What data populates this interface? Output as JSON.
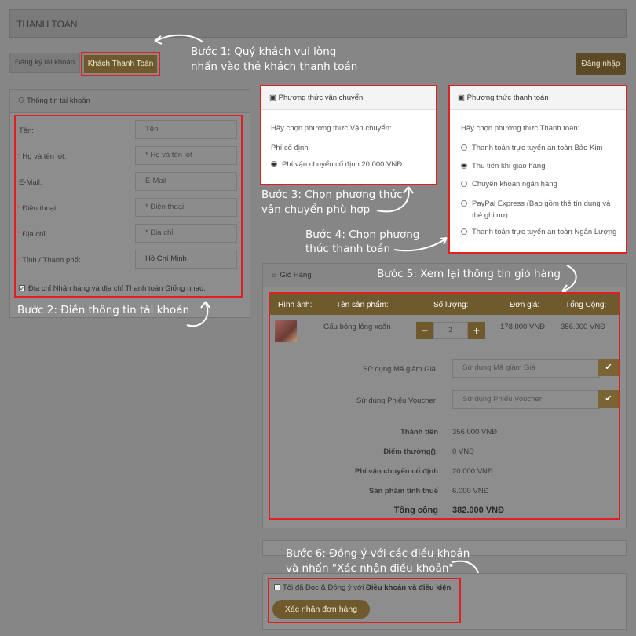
{
  "header": {
    "title": "THANH TOÁN"
  },
  "tabs": {
    "register": "Đăng ký tài khoản",
    "guest": "Khách Thanh Toán"
  },
  "login_button": "Đăng nhập",
  "steps": {
    "s1_line1": "Bước 1: Quý khách vui lòng",
    "s1_line2": "nhấn vào thẻ khách thanh toán",
    "s2": "Bước 2: Điền thông tin tài khoản",
    "s3_line1": "Bước 3: Chọn phương thức",
    "s3_line2": "vận chuyển phù hợp",
    "s4_line1": "Bước 4: Chọn phương",
    "s4_line2": "thức thanh toán",
    "s5": "Bước 5: Xem lại thông tin giỏ hàng",
    "s6_line1": "Bước 6: Đồng ý với các điều khoản",
    "s6_line2": "và nhấn \"Xác nhận điều khoản\""
  },
  "account": {
    "title": "Thông tin tài khoản",
    "fields": [
      {
        "label": "Tên:",
        "required": false,
        "placeholder": "Tên"
      },
      {
        "label": "Họ và tên lót:",
        "required": true,
        "placeholder": "* Họ và tên lót"
      },
      {
        "label": "E-Mail:",
        "required": false,
        "placeholder": "E-Mail"
      },
      {
        "label": "Điện thoại:",
        "required": true,
        "placeholder": "* Điện thoại"
      },
      {
        "label": "Địa chỉ:",
        "required": true,
        "placeholder": "* Địa chỉ"
      },
      {
        "label": "Tỉnh / Thành phố:",
        "required": true,
        "value": "Hồ Chí Minh"
      }
    ],
    "same_address": "Địa chỉ Nhận hàng và địa chỉ Thanh toán Giống nhau."
  },
  "shipping": {
    "title": "Phương thức vận chuyển",
    "prompt": "Hãy chọn phương thức Vận chuyển:",
    "group": "Phí cố định",
    "option": "Phí vận chuyển cố định 20.000 VNĐ"
  },
  "payment": {
    "title": "Phương thức thanh toán",
    "prompt": "Hãy chọn phương thức Thanh toán:",
    "options": [
      {
        "label": "Thanh toán trực tuyến an toàn Bảo Kim",
        "selected": false
      },
      {
        "label": "Thu tiền khi giao hàng",
        "selected": true
      },
      {
        "label": "Chuyển khoản ngân hàng",
        "selected": false
      },
      {
        "label": "PayPal Express (Bao gồm thẻ tín dụng và thẻ ghi nợ)",
        "selected": false
      },
      {
        "label": "Thanh toán trực tuyến an toàn Ngân Lượng",
        "selected": false
      }
    ]
  },
  "cart": {
    "title": "Giỏ Hàng",
    "headers": [
      "Hình ảnh:",
      "Tên sản phẩm:",
      "Số lượng:",
      "Đơn giá:",
      "Tổng Cộng:"
    ],
    "item": {
      "name": "Gấu bông lông xoắn",
      "qty": "2",
      "price": "178.000 VNĐ",
      "total": "356.000 VNĐ"
    },
    "coupon_label": "Sử dụng Mã giảm Giá",
    "coupon_placeholder": "Sử dụng Mã giảm Giá",
    "voucher_label": "Sử dụng Phiếu Voucher",
    "voucher_placeholder": "Sử dụng Phiếu Voucher",
    "summary": [
      {
        "label": "Thành tiền",
        "value": "356.000 VNĐ"
      },
      {
        "label": "Điểm thưởng():",
        "value": "0 VNĐ"
      },
      {
        "label": "Phí vận chuyển cố định",
        "value": "20.000 VNĐ"
      },
      {
        "label": "Sản phẩm tính thuế",
        "value": "6.000 VNĐ"
      }
    ],
    "grand_label": "Tổng cộng",
    "grand_value": "382.000 VNĐ"
  },
  "terms": {
    "text_prefix": "Tôi đã Đọc & Đồng ý với ",
    "text_bold": "Điều khoản và điều kiện",
    "confirm_button": "Xác nhận đơn hàng"
  },
  "colors": {
    "accent": "#6f5a2e",
    "highlight": "#e02020",
    "overlay": "#868686"
  }
}
